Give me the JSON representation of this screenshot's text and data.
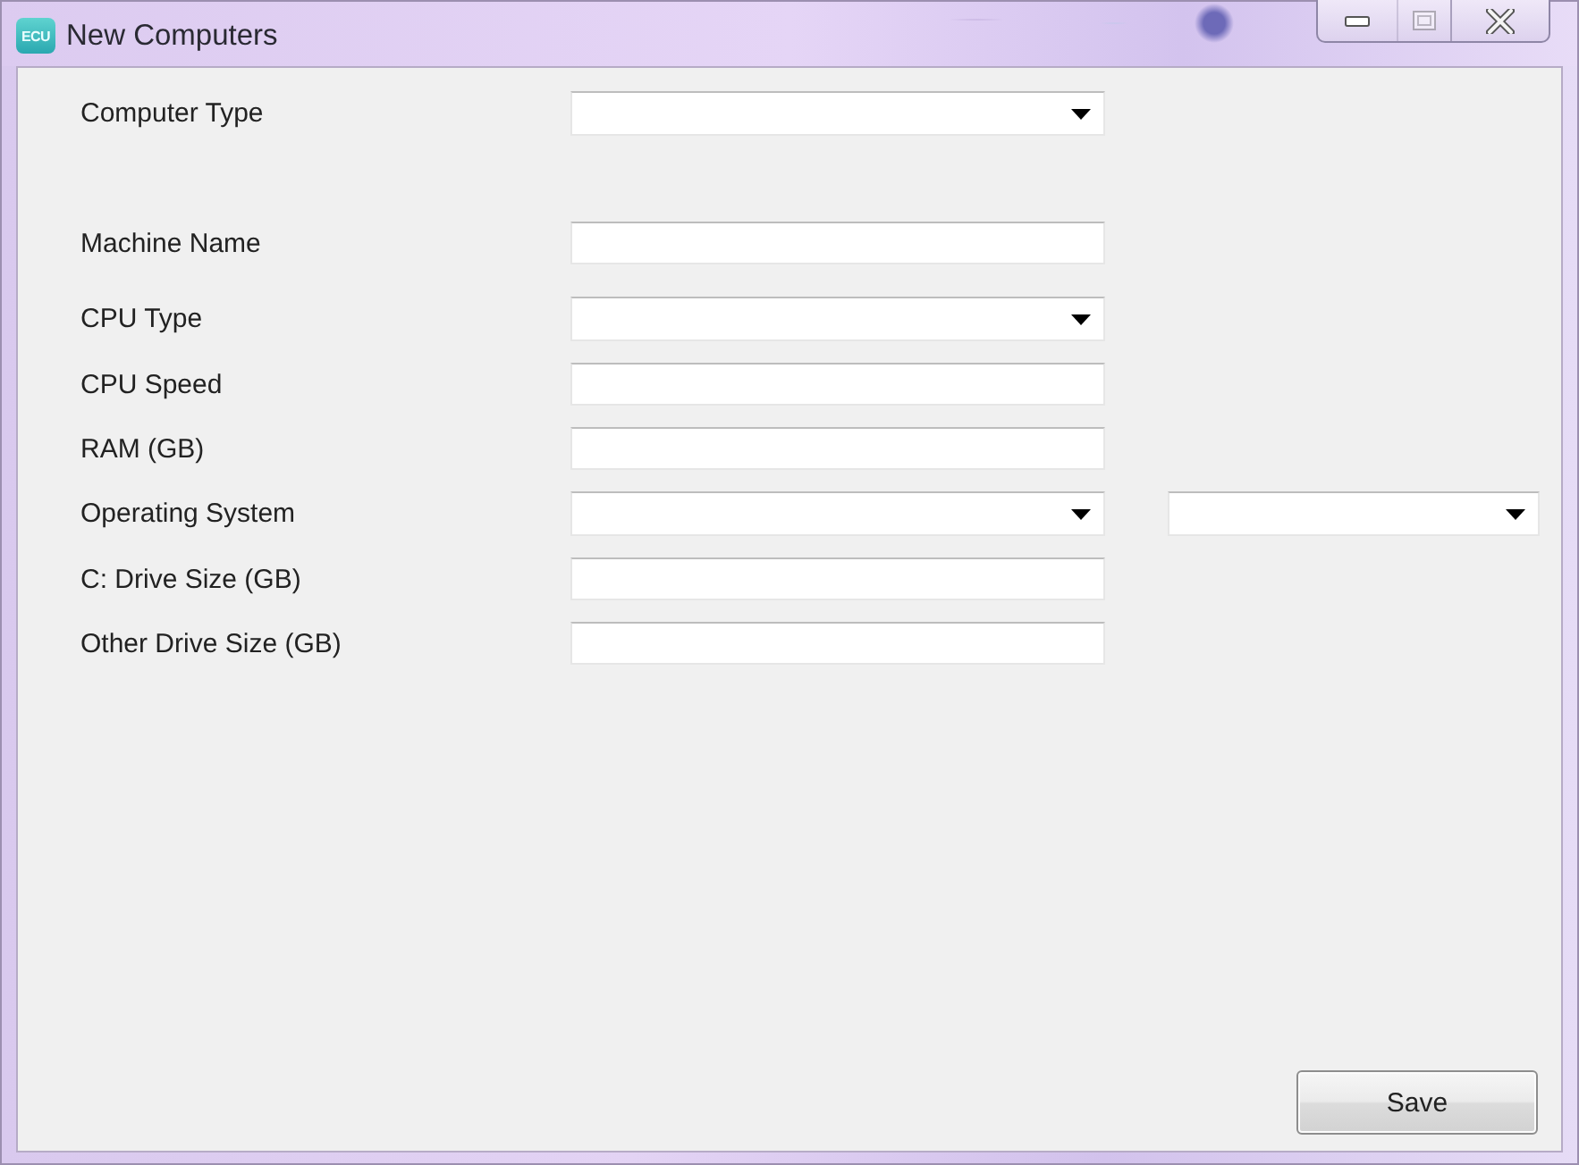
{
  "window": {
    "title": "New Computers",
    "icon_text": "ECU"
  },
  "window_controls": [
    {
      "kind": "minimize",
      "disabled": false
    },
    {
      "kind": "maximize",
      "disabled": true
    },
    {
      "kind": "close",
      "disabled": false
    }
  ],
  "fields": [
    {
      "label": "Computer Type",
      "controls": [
        {
          "kind": "dropdown"
        }
      ]
    },
    {
      "label": "Machine Name",
      "controls": [
        {
          "kind": "text"
        }
      ]
    },
    {
      "label": "CPU Type",
      "controls": [
        {
          "kind": "dropdown"
        }
      ]
    },
    {
      "label": "CPU Speed",
      "controls": [
        {
          "kind": "text"
        }
      ]
    },
    {
      "label": "RAM (GB)",
      "controls": [
        {
          "kind": "text"
        }
      ]
    },
    {
      "label": "Operating System",
      "controls": [
        {
          "kind": "dropdown"
        },
        {
          "kind": "dropdown"
        }
      ]
    },
    {
      "label": "C: Drive Size (GB)",
      "controls": [
        {
          "kind": "text"
        }
      ]
    },
    {
      "label": "Other Drive Size (GB)",
      "controls": [
        {
          "kind": "text"
        }
      ]
    }
  ],
  "buttons": [
    {
      "label": "Save"
    }
  ]
}
